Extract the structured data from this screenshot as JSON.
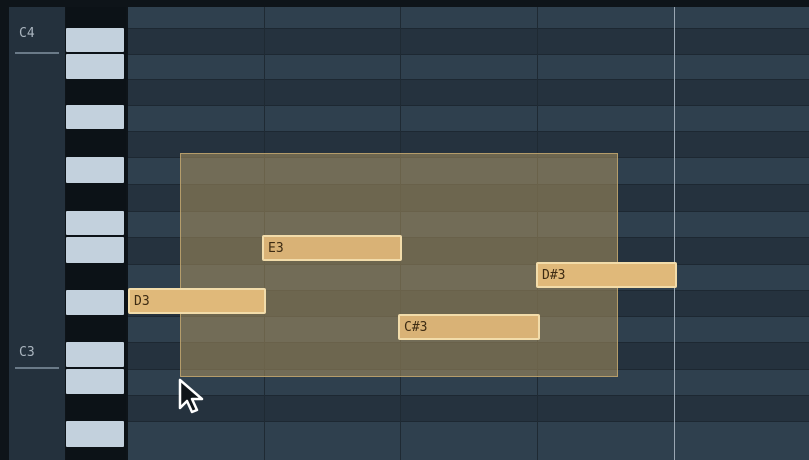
{
  "octave_labels": {
    "c4": "C4",
    "c3": "C3"
  },
  "notes": {
    "d3": "D3",
    "e3": "E3",
    "cs3": "C#3",
    "ds3": "D#3"
  },
  "colors": {
    "note_fill": "#e0b97a",
    "note_border": "#f2dcaa",
    "selection_fill": "#b0955f",
    "background": "#2d3d4b",
    "keyboard_white": "#c3d1dd"
  },
  "icons": {
    "pointer": "mouse-pointer-icon"
  }
}
